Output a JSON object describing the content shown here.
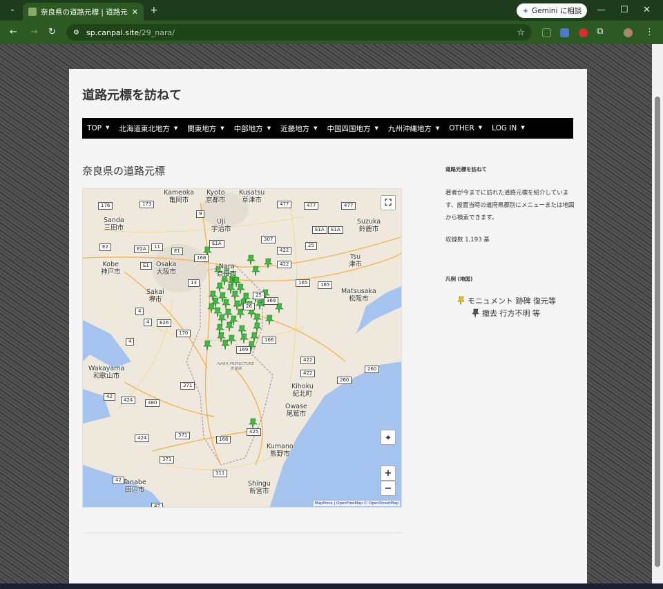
{
  "browser": {
    "tab_title": "奈良県の道路元標 | 道路元標を訪",
    "gemini_label": "Gemini に相談",
    "url_host": "sp.canpal.site",
    "url_path": "/29_nara/"
  },
  "site": {
    "title": "道路元標を訪ねて",
    "nav": [
      {
        "label": "TOP"
      },
      {
        "label": "北海道東北地方"
      },
      {
        "label": "関東地方"
      },
      {
        "label": "中部地方"
      },
      {
        "label": "近畿地方"
      },
      {
        "label": "中国四国地方"
      },
      {
        "label": "九州沖縄地方"
      },
      {
        "label": "OTHER"
      },
      {
        "label": "LOG IN"
      }
    ],
    "page_heading": "奈良県の道路元標"
  },
  "map": {
    "attribution": "MapPress | OpenFreeMap © OpenStreetMap",
    "zoom_in": "+",
    "zoom_out": "−",
    "places": {
      "kameoka": "Kameoka\n亀岡市",
      "kyoto": "Kyoto\n京都市",
      "kusatsu": "Kusatsu\n草津市",
      "sanda": "Sanda\n三田市",
      "uji": "Uji\n宇治市",
      "suzuka": "Suzuka\n鈴鹿市",
      "kobe": "Kobe\n神戸市",
      "osaka": "Osaka\n大阪市",
      "nara": "Nara\n奈良市",
      "tsu": "Tsu\n津市",
      "sakai": "Sakai\n堺市",
      "matsusaka": "Matsusaka\n松阪市",
      "wakayama": "Wakayama\n和歌山市",
      "prefecture": "NARA PREFECTURE\n奈良県",
      "kihoku": "Kihoku\n紀北町",
      "owase": "Owase\n尾鷲市",
      "kumano": "Kumano\n熊野市",
      "tanabe": "Tanabe\n田辺市",
      "shingu": "Shingu\n新宮市"
    },
    "route_shields": [
      "176",
      "173",
      "9",
      "477",
      "477",
      "477",
      "E1A",
      "E1A",
      "E2",
      "E2A",
      "11",
      "E1",
      "E1A",
      "307",
      "422",
      "25",
      "168",
      "422",
      "E1",
      "13",
      "165",
      "165",
      "25",
      "369",
      "26",
      "E26",
      "170",
      "166",
      "169",
      "4",
      "422",
      "422",
      "260",
      "260",
      "371",
      "42",
      "424",
      "480",
      "424",
      "371",
      "168",
      "425",
      "311",
      "42",
      "371",
      "42",
      "4",
      "4"
    ],
    "marker_color": "#3dbd3d"
  },
  "sidebar": {
    "title": "道路元標を訪ねて",
    "description": "著者が今までに訪れた道路元標を紹介しています、設置当時の道府県郡別にメニューまたは地図から検索できます。",
    "count": "収録数 1,193 基",
    "legend_title": "凡例 (地図)",
    "legend": [
      {
        "label": "モニュメント 跡碑 復元等",
        "color": "#e8c020"
      },
      {
        "label": "撤去 行方不明 等",
        "color": "#555555"
      }
    ]
  }
}
